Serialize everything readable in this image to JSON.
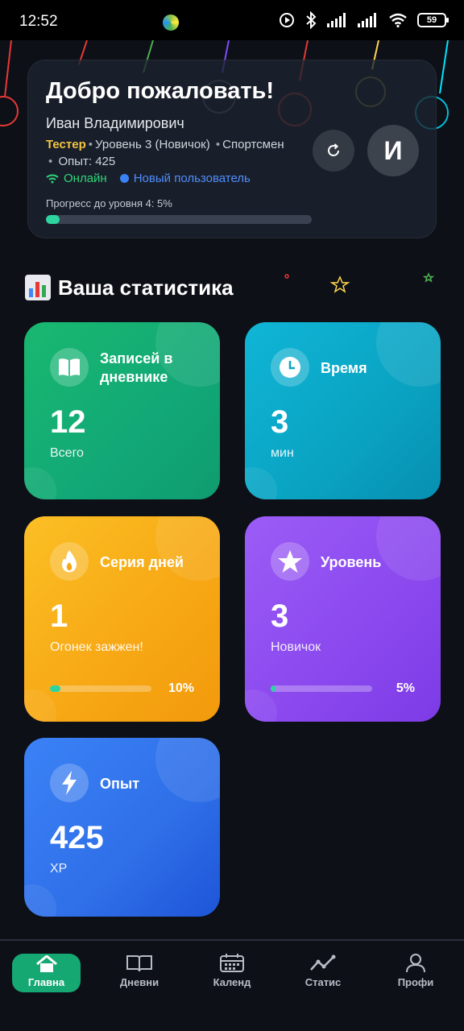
{
  "status_bar": {
    "time": "12:52",
    "battery": "59"
  },
  "welcome": {
    "title": "Добро пожаловать!",
    "name": "Иван Владимирович",
    "role": "Тестер",
    "level_text": "Уровень 3 (Новичок)",
    "category": "Спортсмен",
    "xp_text": "Опыт: 425",
    "online": "Онлайн",
    "new_user": "Новый пользователь",
    "progress_label": "Прогресс до уровня 4: 5%",
    "progress": 0.05,
    "avatar_letter": "И"
  },
  "stats": {
    "title": "Ваша статистика",
    "entries": {
      "label": "Записей в дневнике",
      "value": "12",
      "sub": "Всего",
      "icon": "book-icon"
    },
    "time": {
      "label": "Время",
      "value": "3",
      "sub": "мин",
      "icon": "clock-icon"
    },
    "streak": {
      "label": "Серия дней",
      "value": "1",
      "sub": "Огонек зажжен!",
      "percent": "10%",
      "progress": 0.1,
      "icon": "flame-icon"
    },
    "level": {
      "label": "Уровень",
      "value": "3",
      "sub": "Новичок",
      "percent": "5%",
      "progress": 0.05,
      "icon": "star-icon"
    },
    "xp": {
      "label": "Опыт",
      "value": "425",
      "sub": "XP",
      "icon": "bolt-icon"
    }
  },
  "nav": [
    {
      "label": "Главна",
      "icon": "home-icon",
      "active": true
    },
    {
      "label": "Дневни",
      "icon": "book-icon"
    },
    {
      "label": "Календ",
      "icon": "calendar-icon"
    },
    {
      "label": "Статис",
      "icon": "stats-icon"
    },
    {
      "label": "Профи",
      "icon": "profile-icon"
    }
  ],
  "colors": {
    "accent_green": "#16a873",
    "entries": "#19b86f",
    "time": "#10b5d6",
    "streak": "#fbbf24",
    "level": "#9b5cf6",
    "xp": "#3b82f6"
  }
}
